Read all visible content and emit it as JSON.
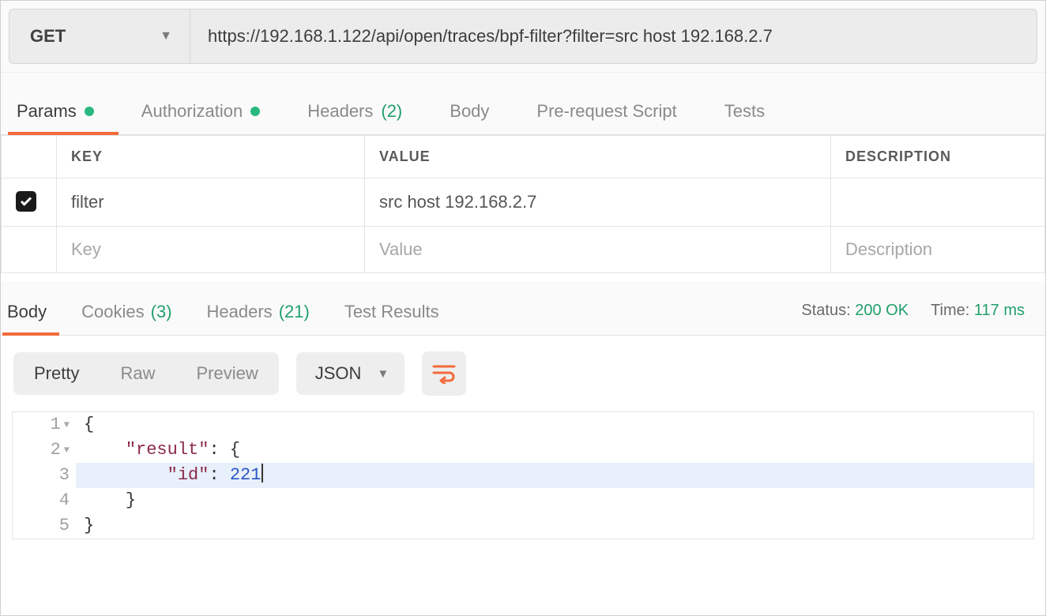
{
  "request": {
    "method": "GET",
    "url": "https://192.168.1.122/api/open/traces/bpf-filter?filter=src host 192.168.2.7"
  },
  "request_tabs": {
    "params": "Params",
    "authorization": "Authorization",
    "headers": "Headers",
    "headers_count": "(2)",
    "body": "Body",
    "pre_request": "Pre-request Script",
    "tests": "Tests"
  },
  "params_table": {
    "header_key": "Key",
    "header_value": "Value",
    "header_desc": "Description",
    "rows": [
      {
        "enabled": true,
        "key": "filter",
        "value": "src host 192.168.2.7",
        "desc": ""
      }
    ],
    "placeholders": {
      "key": "Key",
      "value": "Value",
      "desc": "Description"
    }
  },
  "response_tabs": {
    "body": "Body",
    "cookies": "Cookies",
    "cookies_count": "(3)",
    "headers": "Headers",
    "headers_count": "(21)",
    "test_results": "Test Results"
  },
  "response_meta": {
    "status_label": "Status:",
    "status_value": "200 OK",
    "time_label": "Time:",
    "time_value": "117 ms"
  },
  "viewer": {
    "modes": {
      "pretty": "Pretty",
      "raw": "Raw",
      "preview": "Preview"
    },
    "format": "JSON"
  },
  "code": {
    "lines": [
      {
        "n": "1",
        "indent": 0,
        "foldable": true,
        "tokens": [
          {
            "t": "plain",
            "v": "{"
          }
        ]
      },
      {
        "n": "2",
        "indent": 1,
        "foldable": true,
        "tokens": [
          {
            "t": "key",
            "v": "\"result\""
          },
          {
            "t": "plain",
            "v": ": {"
          }
        ]
      },
      {
        "n": "3",
        "indent": 2,
        "highlight": true,
        "tokens": [
          {
            "t": "key",
            "v": "\"id\""
          },
          {
            "t": "plain",
            "v": ": "
          },
          {
            "t": "num",
            "v": "221"
          }
        ],
        "cursor_after": true
      },
      {
        "n": "4",
        "indent": 1,
        "tokens": [
          {
            "t": "plain",
            "v": "}"
          }
        ]
      },
      {
        "n": "5",
        "indent": 0,
        "tokens": [
          {
            "t": "plain",
            "v": "}"
          }
        ]
      }
    ]
  }
}
